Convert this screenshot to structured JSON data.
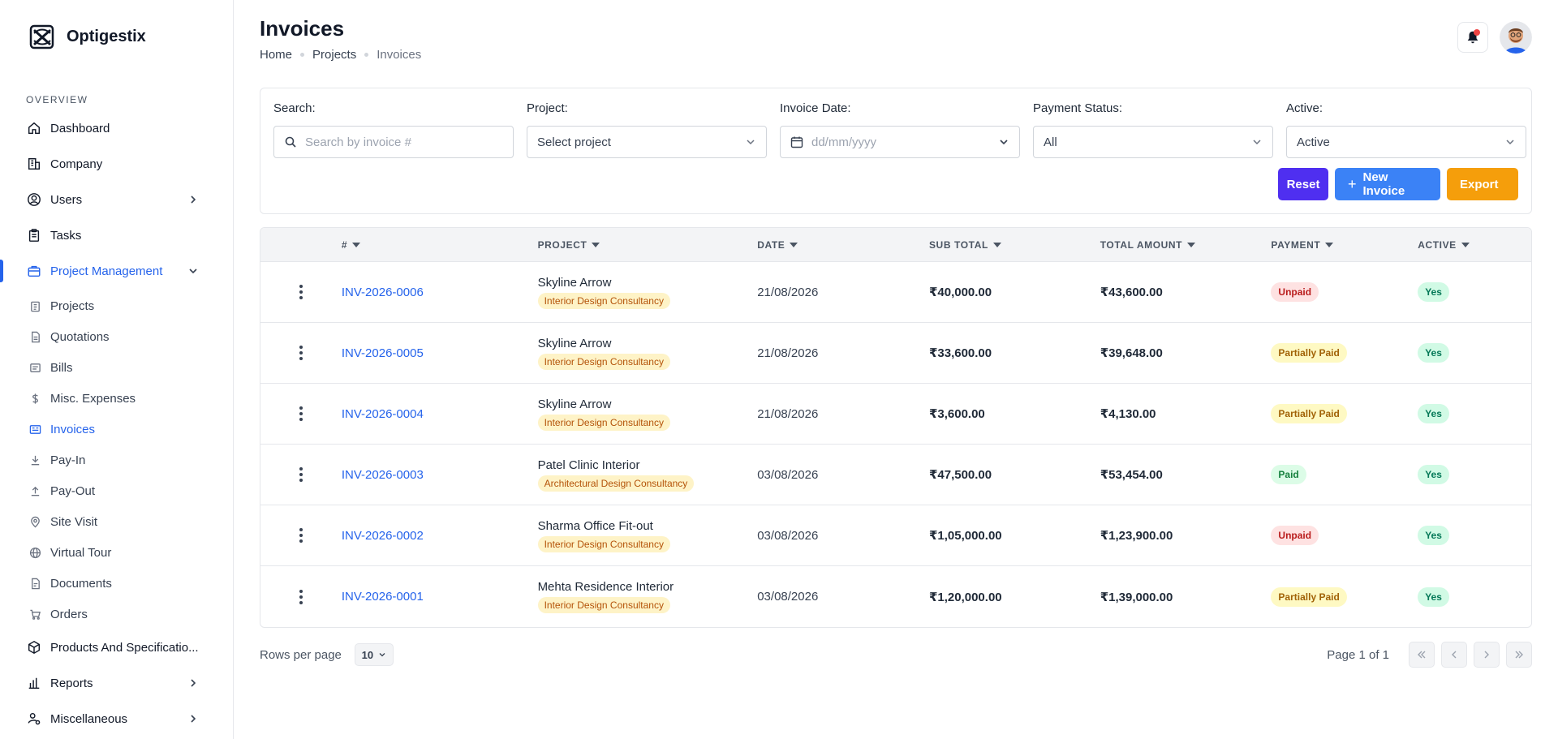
{
  "brand": {
    "name": "Optigestix"
  },
  "sidebar": {
    "section_label": "OVERVIEW",
    "items": [
      {
        "label": "Dashboard",
        "icon": "home-icon"
      },
      {
        "label": "Company",
        "icon": "building-icon"
      },
      {
        "label": "Users",
        "icon": "user-circle-icon",
        "has_children": true
      },
      {
        "label": "Tasks",
        "icon": "clipboard-icon"
      },
      {
        "label": "Project Management",
        "icon": "briefcase-icon",
        "expanded": true,
        "active": true
      },
      {
        "label": "Products And Specificatio...",
        "icon": "box-icon"
      },
      {
        "label": "Reports",
        "icon": "bar-chart-icon",
        "has_children": true
      },
      {
        "label": "Miscellaneous",
        "icon": "user-settings-icon",
        "has_children": true
      }
    ],
    "sub_items": [
      {
        "label": "Projects",
        "icon": "clipboard-list-icon"
      },
      {
        "label": "Quotations",
        "icon": "file-text-icon"
      },
      {
        "label": "Bills",
        "icon": "receipt-icon"
      },
      {
        "label": "Misc. Expenses",
        "icon": "dollar-icon"
      },
      {
        "label": "Invoices",
        "icon": "invoice-icon",
        "active": true
      },
      {
        "label": "Pay-In",
        "icon": "pay-in-icon"
      },
      {
        "label": "Pay-Out",
        "icon": "pay-out-icon"
      },
      {
        "label": "Site Visit",
        "icon": "map-pin-icon"
      },
      {
        "label": "Virtual Tour",
        "icon": "globe-icon"
      },
      {
        "label": "Documents",
        "icon": "document-icon"
      },
      {
        "label": "Orders",
        "icon": "cart-icon"
      }
    ]
  },
  "header": {
    "title": "Invoices",
    "breadcrumb": [
      "Home",
      "Projects",
      "Invoices"
    ]
  },
  "filters": {
    "search": {
      "label": "Search:",
      "placeholder": "Search by invoice #"
    },
    "project": {
      "label": "Project:",
      "value": "Select project"
    },
    "invoice_date": {
      "label": "Invoice Date:",
      "placeholder": "dd/mm/yyyy"
    },
    "payment_status": {
      "label": "Payment Status:",
      "value": "All"
    },
    "active": {
      "label": "Active:",
      "value": "Active"
    }
  },
  "actions": {
    "reset": "Reset",
    "new_invoice": "New Invoice",
    "export": "Export"
  },
  "table": {
    "columns": [
      "#",
      "PROJECT",
      "DATE",
      "SUB TOTAL",
      "TOTAL AMOUNT",
      "PAYMENT",
      "ACTIVE"
    ],
    "rows": [
      {
        "number": "INV-2026-0006",
        "project": "Skyline Arrow",
        "category": "Interior Design Consultancy",
        "date": "21/08/2026",
        "sub_total": "₹40,000.00",
        "total": "₹43,600.00",
        "payment": "Unpaid",
        "payment_status": "unpaid",
        "active": "Yes"
      },
      {
        "number": "INV-2026-0005",
        "project": "Skyline Arrow",
        "category": "Interior Design Consultancy",
        "date": "21/08/2026",
        "sub_total": "₹33,600.00",
        "total": "₹39,648.00",
        "payment": "Partially Paid",
        "payment_status": "partial",
        "active": "Yes"
      },
      {
        "number": "INV-2026-0004",
        "project": "Skyline Arrow",
        "category": "Interior Design Consultancy",
        "date": "21/08/2026",
        "sub_total": "₹3,600.00",
        "total": "₹4,130.00",
        "payment": "Partially Paid",
        "payment_status": "partial",
        "active": "Yes"
      },
      {
        "number": "INV-2026-0003",
        "project": "Patel Clinic Interior",
        "category": "Architectural Design Consultancy",
        "date": "03/08/2026",
        "sub_total": "₹47,500.00",
        "total": "₹53,454.00",
        "payment": "Paid",
        "payment_status": "paid",
        "active": "Yes"
      },
      {
        "number": "INV-2026-0002",
        "project": "Sharma Office Fit-out",
        "category": "Interior Design Consultancy",
        "date": "03/08/2026",
        "sub_total": "₹1,05,000.00",
        "total": "₹1,23,900.00",
        "payment": "Unpaid",
        "payment_status": "unpaid",
        "active": "Yes"
      },
      {
        "number": "INV-2026-0001",
        "project": "Mehta Residence Interior",
        "category": "Interior Design Consultancy",
        "date": "03/08/2026",
        "sub_total": "₹1,20,000.00",
        "total": "₹1,39,000.00",
        "payment": "Partially Paid",
        "payment_status": "partial",
        "active": "Yes"
      }
    ]
  },
  "pagination": {
    "rows_per_page_label": "Rows per page",
    "rows_per_page": "10",
    "page_info": "Page 1 of 1"
  },
  "colors": {
    "primary": "#2563eb",
    "reset": "#4f2ff0",
    "new_invoice": "#3b82f6",
    "export": "#f59e0b",
    "notification_dot": "#ef4444"
  }
}
